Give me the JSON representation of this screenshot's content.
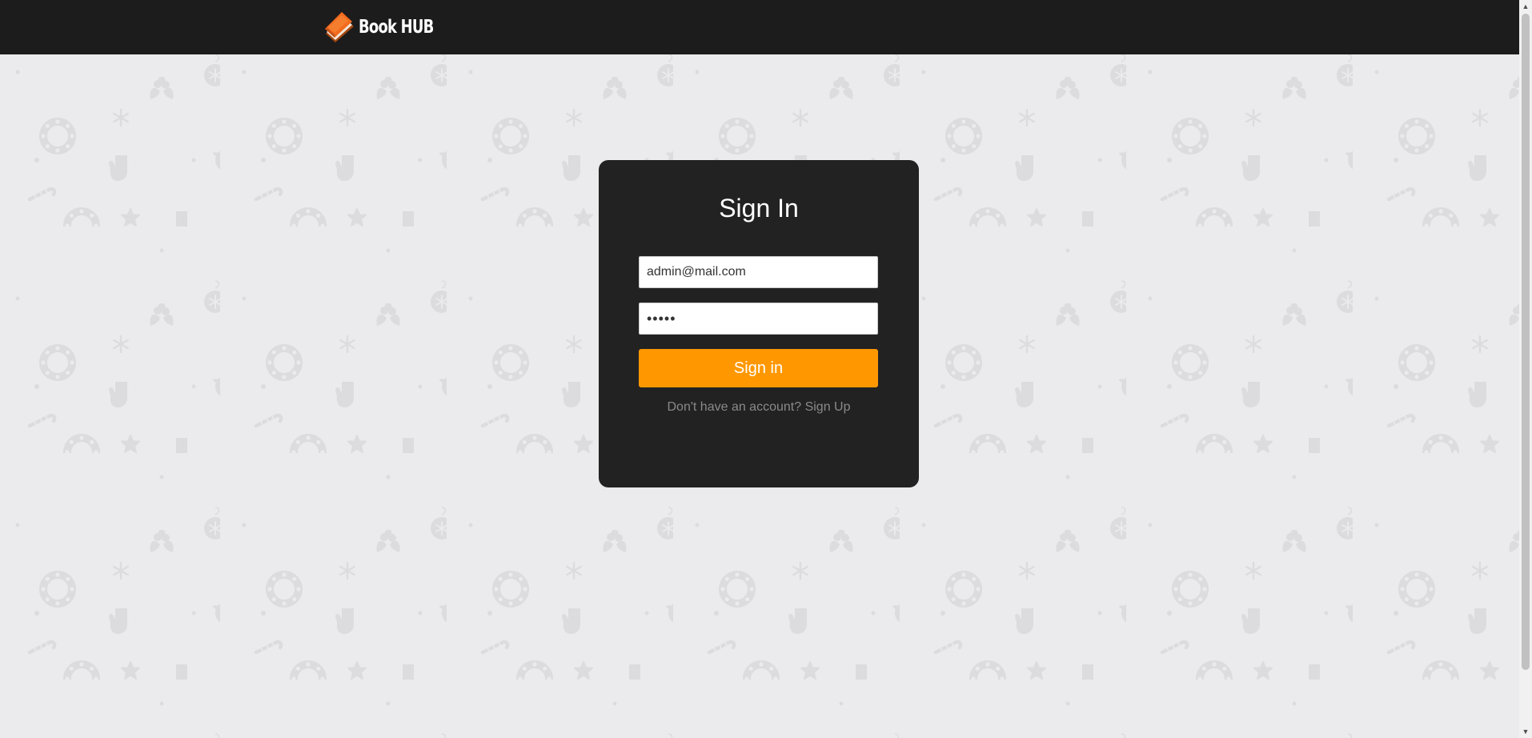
{
  "colors": {
    "background": "#ebebed",
    "pattern_shapes": "#dcdcde",
    "navbar": "#1c1c1c",
    "card": "#222222",
    "accent": "#ff9800",
    "muted_text": "#8a8a8a"
  },
  "navbar": {
    "brand_icon": "book-icon",
    "brand_name": "Book HUB"
  },
  "login": {
    "title": "Sign In",
    "email": {
      "value": "admin@mail.com",
      "placeholder": ""
    },
    "password": {
      "value": "admin",
      "placeholder": ""
    },
    "submit_label": "Sign in",
    "signup_prompt": "Don't have an account?",
    "signup_link": "Sign Up"
  },
  "background_pattern": {
    "motifs": [
      "wreath-icon",
      "snowflake-icon",
      "holly-icon",
      "ornament-icon",
      "star-icon",
      "stocking-icon",
      "mitten-icon",
      "candy-cane-icon"
    ]
  }
}
